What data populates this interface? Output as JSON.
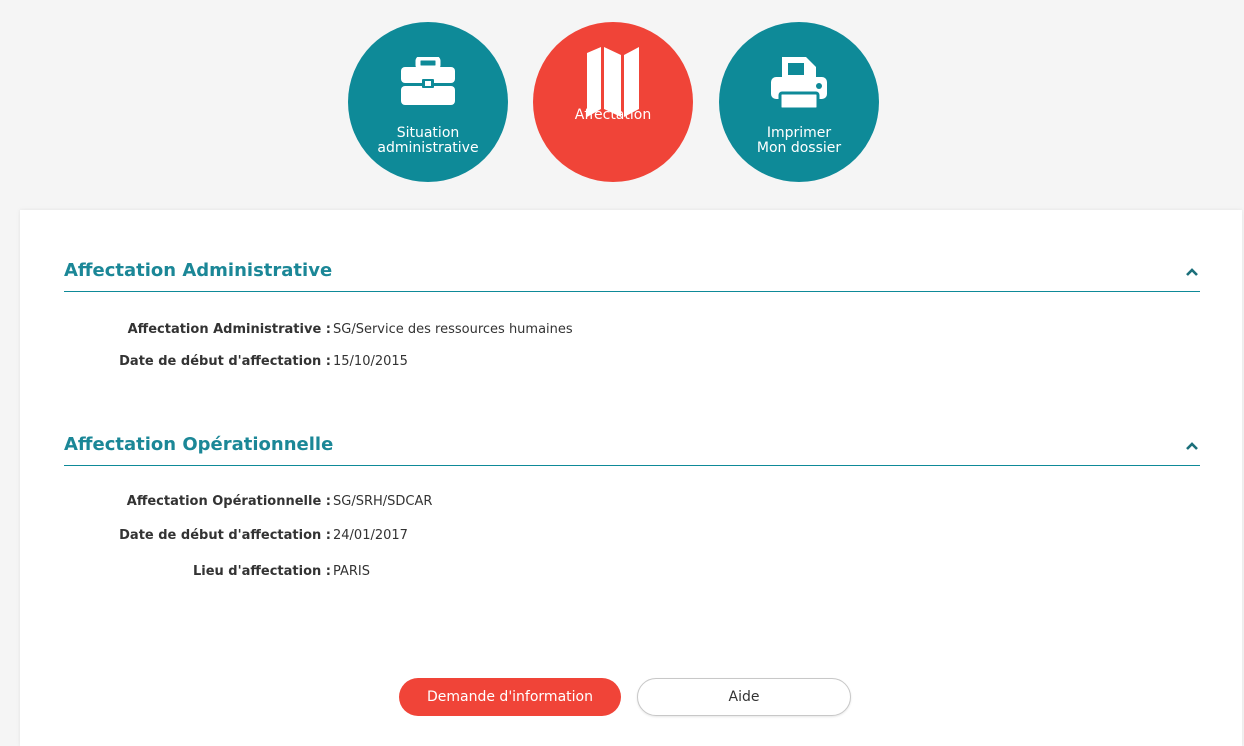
{
  "nav": {
    "items": [
      {
        "label": "Situation\nadministrative",
        "icon": "briefcase-icon",
        "active": false
      },
      {
        "label": "Affectation",
        "icon": "map-icon",
        "active": true
      },
      {
        "label": "Imprimer\nMon dossier",
        "icon": "printer-icon",
        "active": false
      }
    ]
  },
  "sections": [
    {
      "title": "Affectation Administrative",
      "rows": [
        {
          "key": "Affectation Administrative :",
          "value": "SG/Service des ressources humaines"
        },
        {
          "key": "Date de début d'affectation :",
          "value": "15/10/2015"
        }
      ]
    },
    {
      "title": "Affectation Opérationnelle",
      "rows": [
        {
          "key": "Affectation Opérationnelle :",
          "value": "SG/SRH/SDCAR"
        },
        {
          "key": "Date de début d'affectation :",
          "value": "24/01/2017"
        },
        {
          "key": "Lieu d'affectation :",
          "value": "PARIS"
        }
      ]
    }
  ],
  "actions": {
    "request_label": "Demande d'information",
    "help_label": "Aide"
  },
  "colors": {
    "teal": "#0e8a98",
    "red": "#f04438"
  }
}
